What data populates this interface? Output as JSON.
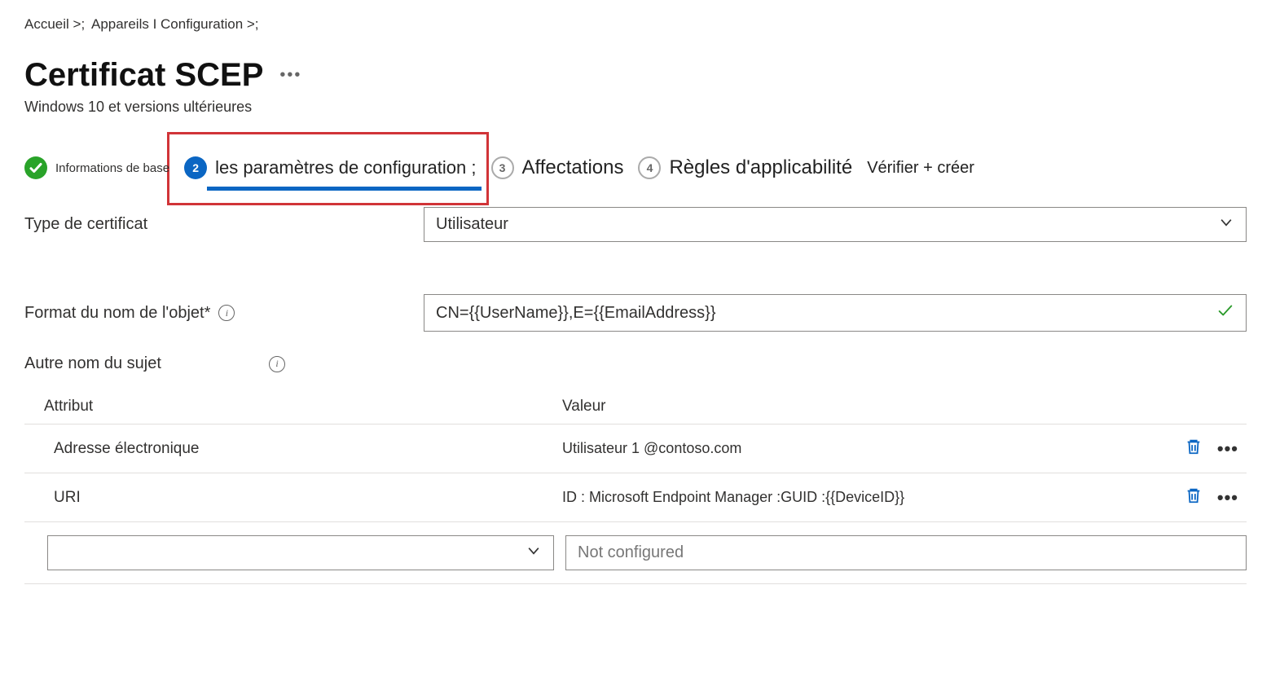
{
  "breadcrumb": {
    "home": "Accueil >;",
    "path": "Appareils I Configuration >;"
  },
  "page": {
    "title": "Certificat SCEP",
    "subtitle": "Windows 10 et versions ultérieures"
  },
  "wizard": {
    "step1": {
      "label": "Informations de base"
    },
    "step2": {
      "number": "2",
      "label": "les paramètres de configuration ;"
    },
    "step3": {
      "number": "3",
      "label": "Affectations"
    },
    "step4": {
      "number": "4",
      "label": "Règles d'applicabilité"
    },
    "step5": {
      "label": "Vérifier + créer"
    }
  },
  "form": {
    "certificate_type_label": "Type de certificat",
    "certificate_type_value": "Utilisateur",
    "subject_name_label": "Format du nom de l'objet*",
    "subject_name_value": "CN={{UserName}},E={{EmailAddress}}",
    "san_label": "Autre nom du sujet"
  },
  "san_table": {
    "header_attr": "Attribut",
    "header_value": "Valeur",
    "rows": [
      {
        "attr": "Adresse électronique",
        "value": "Utilisateur 1 @contoso.com"
      },
      {
        "attr": "URI",
        "value": "ID : Microsoft Endpoint Manager :GUID :{{DeviceID}}"
      }
    ],
    "new_placeholder_select": "",
    "new_placeholder_value": "Not configured"
  }
}
